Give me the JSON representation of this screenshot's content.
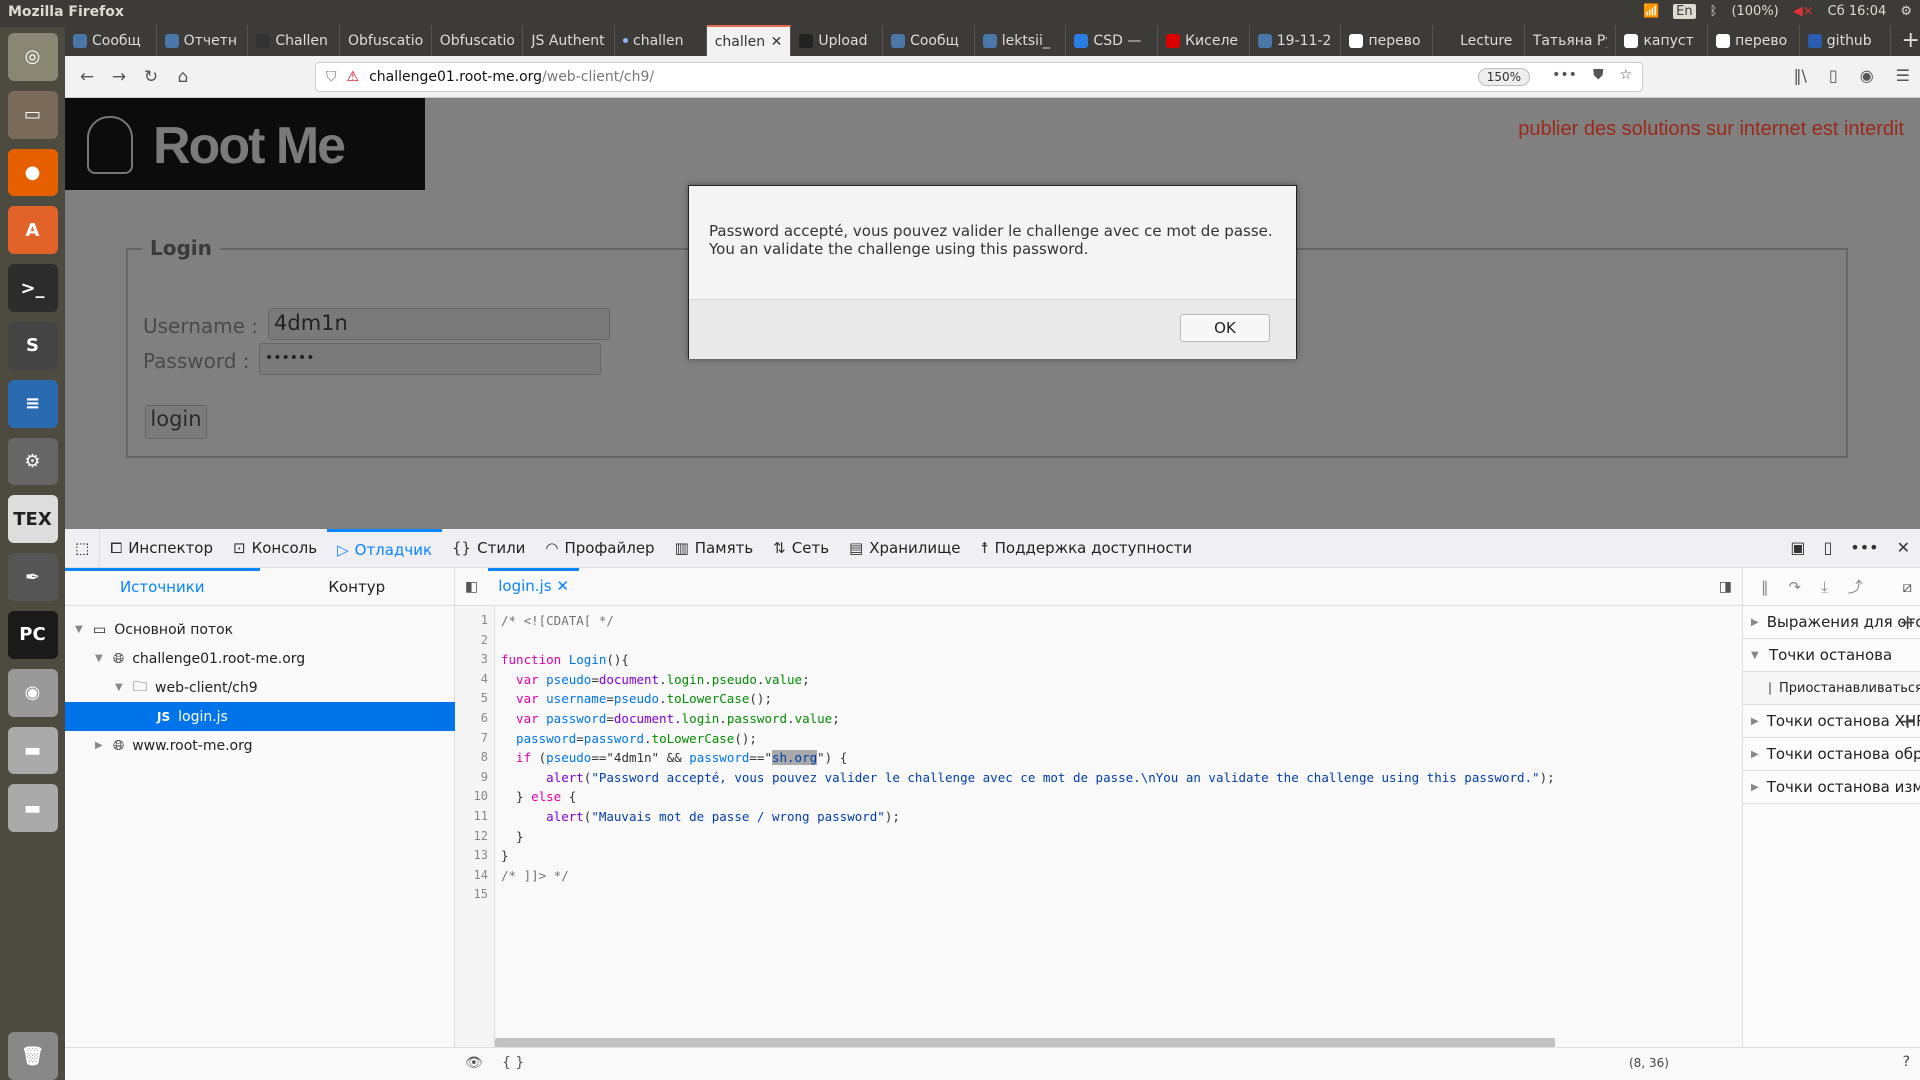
{
  "window": {
    "title": "Mozilla Firefox"
  },
  "tray": {
    "keyboard": "En",
    "battery": "(100%)",
    "clock": "Сб 16:04"
  },
  "tabs": [
    {
      "label": "Сообщ",
      "icon": "chat-icon"
    },
    {
      "label": "Отчетн",
      "icon": "vk-icon"
    },
    {
      "label": "Challen",
      "icon": "rootme-icon"
    },
    {
      "label": "Obfuscatio",
      "icon": ""
    },
    {
      "label": "Obfuscatio",
      "icon": ""
    },
    {
      "label": "JS Authent",
      "icon": ""
    },
    {
      "label": "challen",
      "icon": "dot-icon"
    },
    {
      "label": "challeng",
      "icon": "",
      "active": true
    },
    {
      "label": "Upload",
      "icon": "github-icon"
    },
    {
      "label": "Сообщ",
      "icon": "chat-icon"
    },
    {
      "label": "lektsii_",
      "icon": "vk-icon"
    },
    {
      "label": "CSD —",
      "icon": "csd-icon"
    },
    {
      "label": "Киселе",
      "icon": "pdf-icon"
    },
    {
      "label": "19-11-2",
      "icon": "vk-icon"
    },
    {
      "label": "перево",
      "icon": "google-icon"
    },
    {
      "label": "Lecture",
      "icon": "ni-icon"
    },
    {
      "label": "Татьяна Ру",
      "icon": ""
    },
    {
      "label": "капуст",
      "icon": "google-icon"
    },
    {
      "label": "перево",
      "icon": "google-icon"
    },
    {
      "label": "github",
      "icon": "stackoverflow-icon"
    }
  ],
  "navbar": {
    "url_host": "challenge01.root-me.org",
    "url_path": "/web-client/ch9/",
    "zoom": "150%"
  },
  "page": {
    "logo_text": "Root Me",
    "warning": "publier des solutions sur internet est interdit",
    "legend": "Login",
    "username_label": "Username :",
    "username_value": "4dm1n",
    "password_label": "Password :",
    "password_value": "••••••",
    "login_button": "login"
  },
  "dialog": {
    "line1": "Password accepté, vous pouvez valider le challenge avec ce mot de passe.",
    "line2": "You an validate the challenge using this password.",
    "ok": "OK"
  },
  "devtools": {
    "tabs": [
      "Инспектор",
      "Консоль",
      "Отладчик",
      "Стили",
      "Профайлер",
      "Память",
      "Сеть",
      "Хранилище",
      "Поддержка доступности"
    ],
    "active_tab": "Отладчик",
    "sidebar_tabs": [
      "Источники",
      "Контур"
    ],
    "tree": [
      "Основной поток",
      "challenge01.root-me.org",
      "web-client/ch9",
      "login.js",
      "www.root-me.org"
    ],
    "file_tab": "login.js",
    "js_badge": "JS",
    "panels": [
      "Выражения для отсл…",
      "Точки останова",
      "Приостанавливаться н…",
      "Точки останова XHR",
      "Точки останова обработч…",
      "Точки останова изменен…"
    ],
    "cursor_position": "(8, 36)",
    "pretty_print": "{ }"
  },
  "code": {
    "line_numbers": [
      "1",
      "2",
      "3",
      "4",
      "5",
      "6",
      "7",
      "8",
      "9",
      "10",
      "11",
      "12",
      "13",
      "14",
      "15"
    ],
    "l1": "/* <![CDATA[ */",
    "l3a": "function",
    "l3b": " Login",
    "l3c": "(){",
    "l4a": "  var ",
    "l4b": "pseudo",
    "l4c": "=",
    "l4d": "document",
    ".": ".",
    "l4e": "login",
    "l4f": "pseudo",
    "l4g": "value",
    "l4h": ";",
    "l5b": "username",
    "l5d": "pseudo",
    "l5e": "toLowerCase",
    "l5f": "();",
    "l6b": "password",
    "l6d": "document",
    "l6e": "login",
    "l6f": "password",
    "l6g": "value",
    "l7a": "  password",
    "l7b": "password",
    "l7c": "toLowerCase",
    "l8a": "  if ",
    "l8b": "(",
    "l8c": "pseudo",
    "l8d": "==",
    "l8e": "\"4dm1n\"",
    "l8f": " && ",
    "l8g": "password",
    "l8h": "==\"",
    "l8i": "sh.org",
    "l8j": "\") {",
    "l9a": "      alert",
    "l9b": "(",
    "l9c": "\"Password accepté, vous pouvez valider le challenge avec ce mot de passe.\\nYou an validate the challenge using this password.\"",
    "l9d": ");",
    "l10a": "  } ",
    "l10b": "else",
    "l10c": " {",
    "l11a": "      alert",
    "l11c": "\"Mauvais mot de passe / wrong password\"",
    "l12": "  }",
    "l13": "}",
    "l14": "/* ]]> */"
  }
}
